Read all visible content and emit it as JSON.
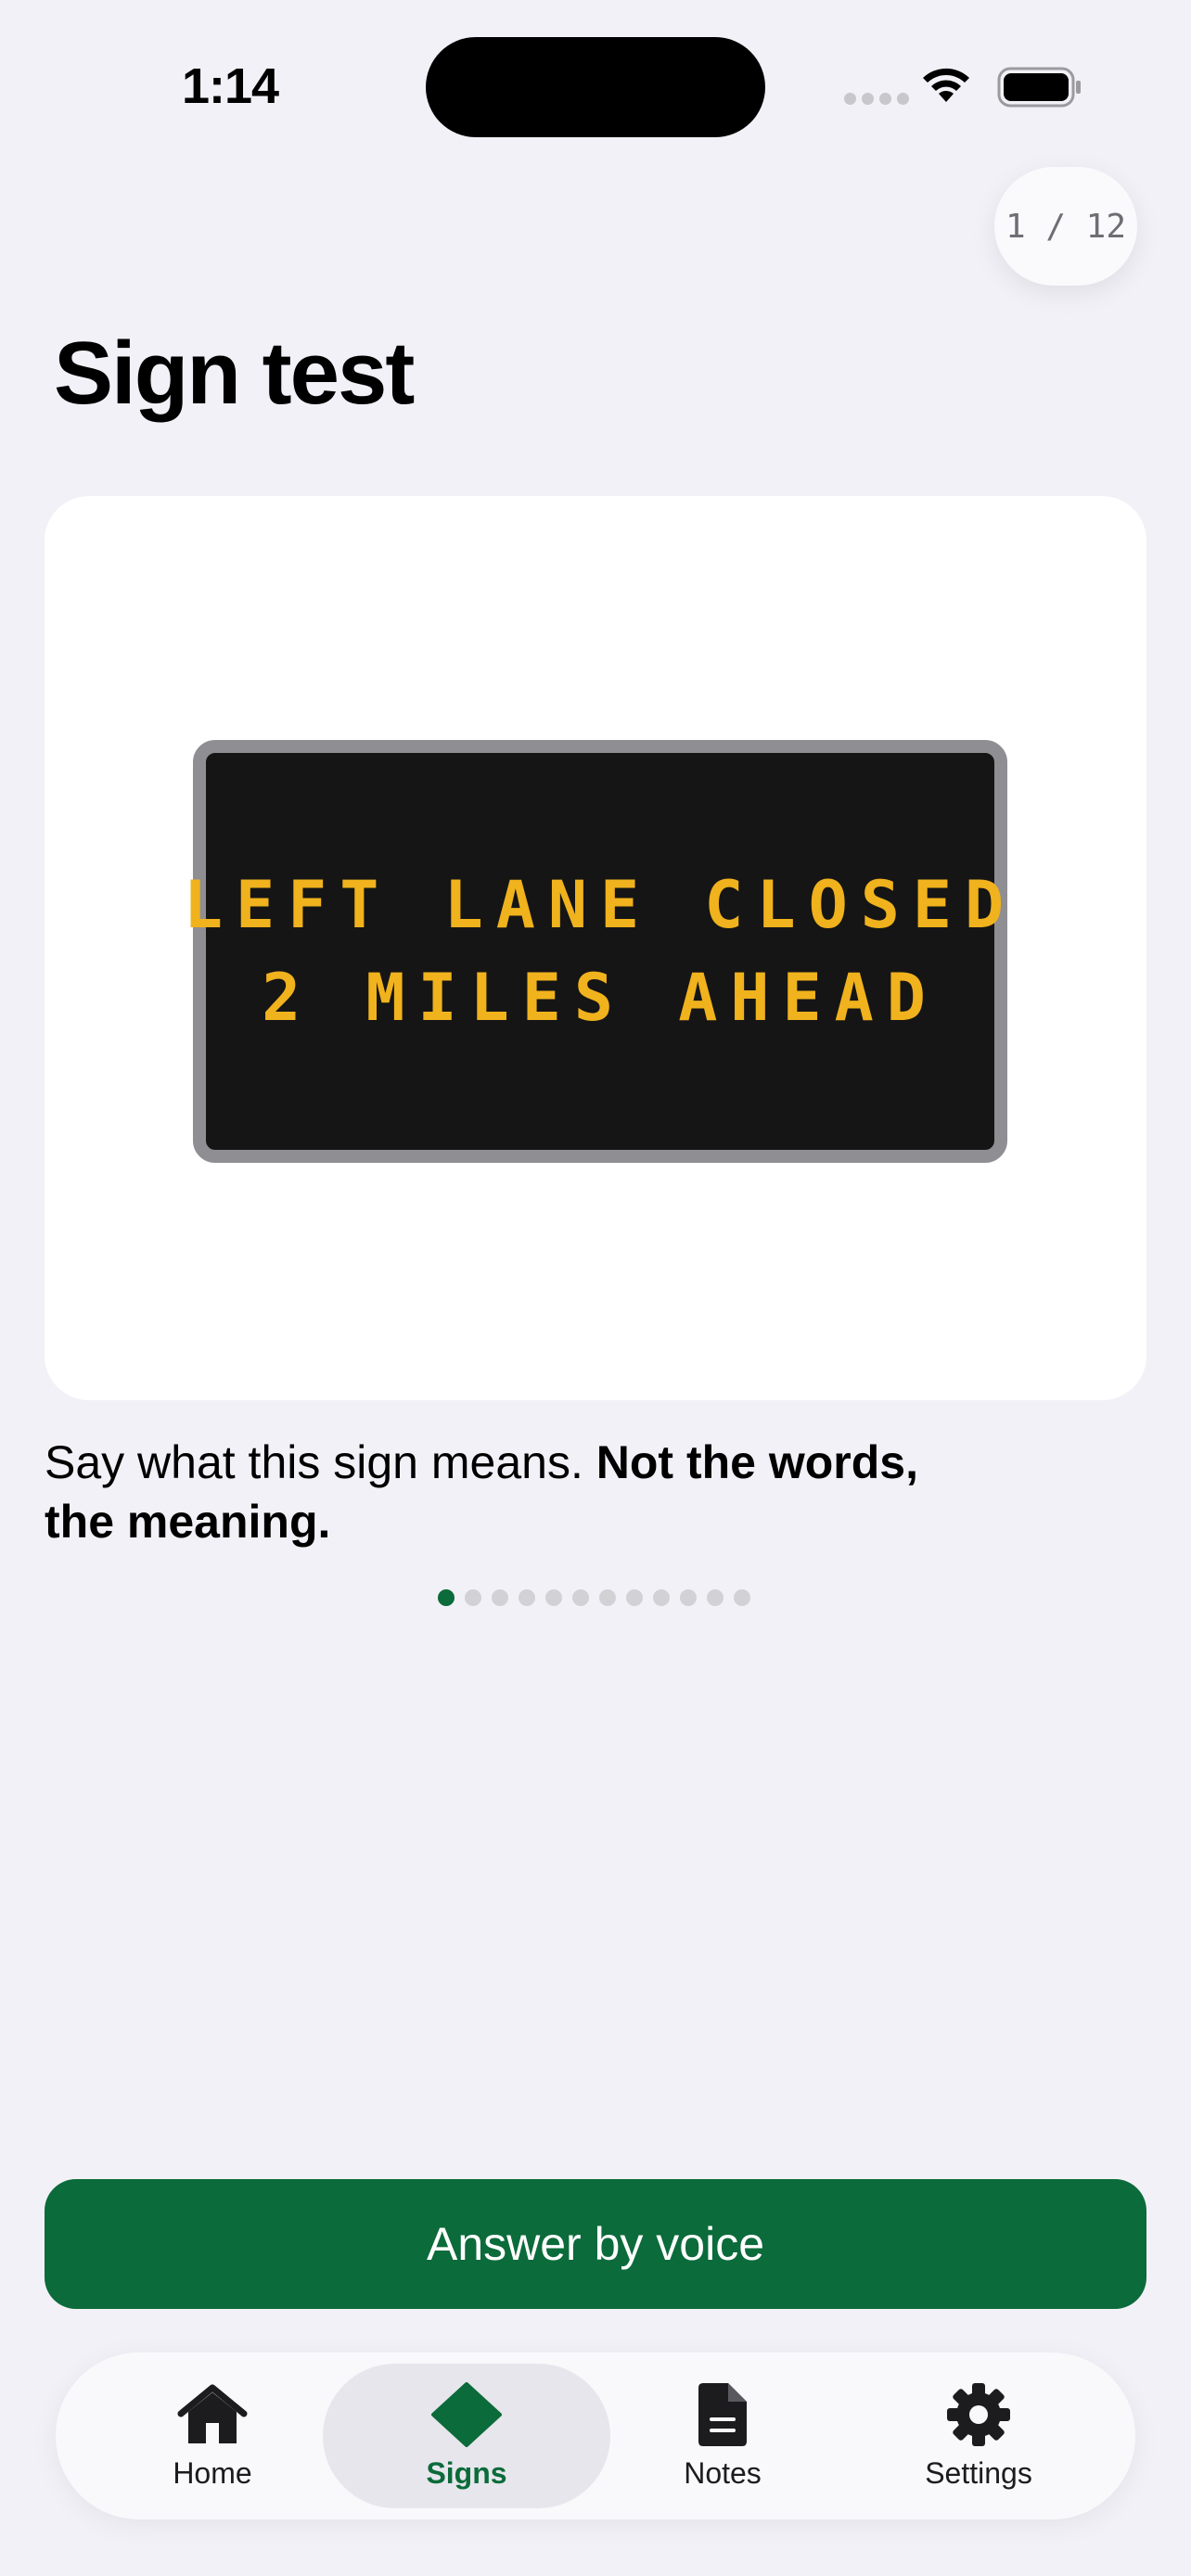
{
  "status_bar": {
    "time": "1:14"
  },
  "progress": {
    "counter": "1 / 12",
    "current": 1,
    "total": 12
  },
  "page_title": "Sign test",
  "sign": {
    "line1": "LEFT LANE CLOSED",
    "line2": "2 MILES AHEAD",
    "text_color": "#f0b21d"
  },
  "prompt": {
    "text": "Say what this sign means.",
    "emphasis": "Not the words, the meaning."
  },
  "answer_button": {
    "label": "Answer by voice",
    "color": "#0b6b3a"
  },
  "tabs": [
    {
      "label": "Home",
      "icon": "house-icon"
    },
    {
      "label": "Signs",
      "icon": "diamond-sign-icon",
      "active": true
    },
    {
      "label": "Notes",
      "icon": "document-icon"
    },
    {
      "label": "Settings",
      "icon": "gear-icon"
    }
  ],
  "colors": {
    "accent": "#0b6b3a",
    "background": "#f2f1f7"
  }
}
